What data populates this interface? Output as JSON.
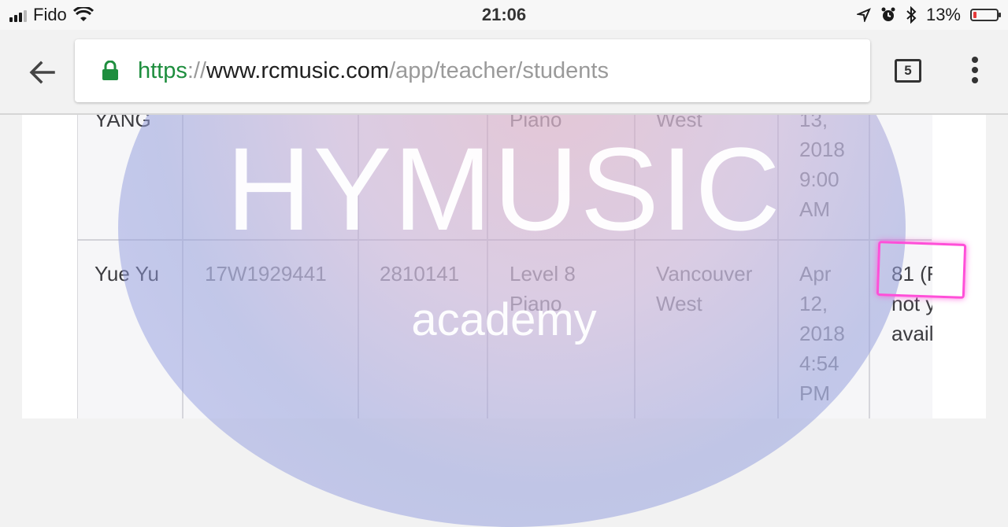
{
  "status_bar": {
    "carrier": "Fido",
    "time": "21:06",
    "battery_percent": "13%",
    "battery_level": 0.13,
    "icons": [
      "signal-icon",
      "wifi-icon",
      "location-icon",
      "alarm-icon",
      "bluetooth-icon",
      "battery-icon"
    ]
  },
  "browser": {
    "url_scheme": "https",
    "url_separator": "://",
    "url_host": "www.rcmusic.com",
    "url_path": "/app/teacher/students",
    "tab_count": "5",
    "accent_color": "#1e8e3e"
  },
  "table": {
    "rows": [
      {
        "name": "YANG",
        "col2": "",
        "col3": "",
        "level": "Piano",
        "location": "West",
        "date_lines": [
          "13,",
          "2018",
          "9:00",
          "AM"
        ],
        "result_lines": []
      },
      {
        "name": "Yue Yu",
        "col2": "17W1929441",
        "col3": "2810141",
        "level_lines": [
          "Level 8",
          "Piano"
        ],
        "location_lines": [
          "Vancouver",
          "West"
        ],
        "date_lines": [
          "Apr",
          "12,",
          "2018",
          "4:54",
          "PM"
        ],
        "result_lines": [
          "81 (F",
          "not y",
          "avail"
        ]
      }
    ]
  },
  "watermark": {
    "title": "HYMUSIC",
    "subtitle": "academy"
  },
  "highlight_color": "#ff4fd8"
}
